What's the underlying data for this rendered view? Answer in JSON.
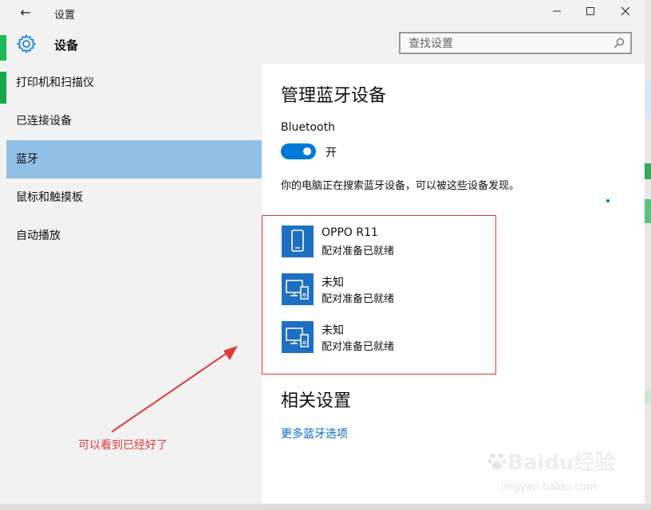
{
  "titlebar": {
    "back_label": "←",
    "title": "设置",
    "minimize": "—",
    "maximize": "☐",
    "close": "✕"
  },
  "header": {
    "title": "设备",
    "search_placeholder": "查找设置"
  },
  "sidebar": {
    "items": [
      {
        "label": "打印机和扫描仪",
        "active": false
      },
      {
        "label": "已连接设备",
        "active": false
      },
      {
        "label": "蓝牙",
        "active": true
      },
      {
        "label": "鼠标和触摸板",
        "active": false
      },
      {
        "label": "自动播放",
        "active": false
      }
    ]
  },
  "main": {
    "heading": "管理蓝牙设备",
    "bluetooth_label": "Bluetooth",
    "toggle_state": "开",
    "status_text": "你的电脑正在搜索蓝牙设备，可以被这些设备发现。",
    "devices": [
      {
        "name": "OPPO R11",
        "status": "配对准备已就绪",
        "icon": "phone-icon"
      },
      {
        "name": "未知",
        "status": "配对准备已就绪",
        "icon": "device-icon"
      },
      {
        "name": "未知",
        "status": "配对准备已就绪",
        "icon": "device-icon"
      }
    ],
    "related_heading": "相关设置",
    "more_link": "更多蓝牙选项"
  },
  "annotation": {
    "text": "可以看到已经好了"
  },
  "watermark": {
    "logo_text": "Baidu经验",
    "url_text": "jingyan.baidu.com"
  },
  "colors": {
    "accent": "#0078d7",
    "selected_nav": "#90bfe6",
    "annotation_red": "#e03a3a",
    "link": "#0a68c4"
  }
}
